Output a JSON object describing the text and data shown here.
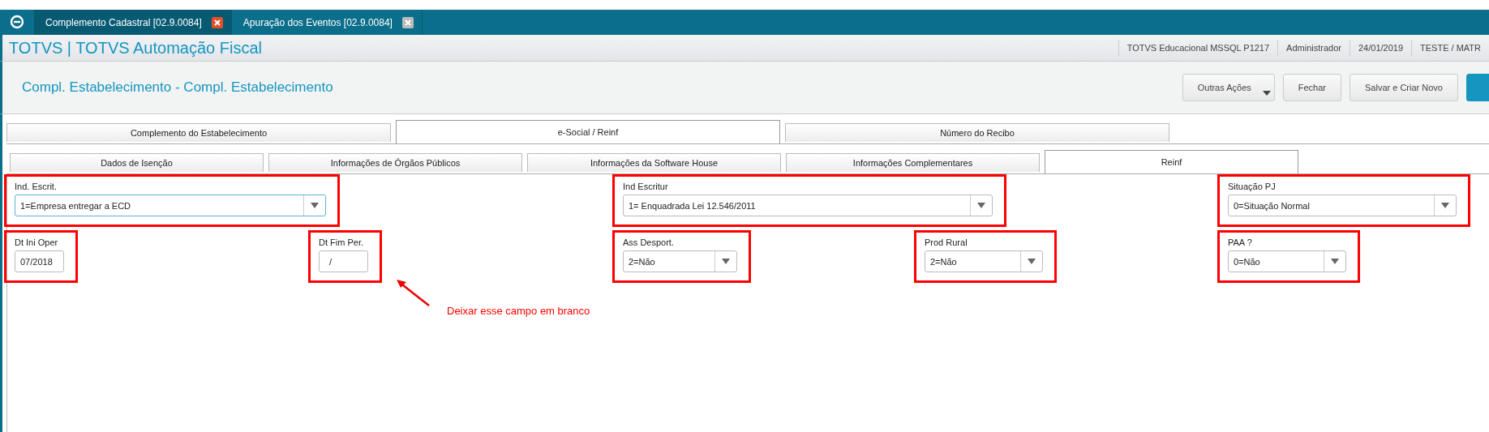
{
  "window_tabs": [
    {
      "label": "Complemento Cadastral [02.9.0084]",
      "selected": true
    },
    {
      "label": "Apuração dos Eventos [02.9.0084]",
      "selected": false
    }
  ],
  "app_title": "TOTVS | TOTVS Automação Fiscal",
  "status_info": [
    "TOTVS Educacional MSSQL P1217",
    "Administrador",
    "24/01/2019",
    "TESTE / MATR"
  ],
  "page_title": "Compl. Estabelecimento - Compl. Estabelecimento",
  "actions": [
    {
      "label": "Outras Ações",
      "kind": "menu"
    },
    {
      "label": "Fechar",
      "kind": "plain"
    },
    {
      "label": "Salvar e Criar Novo",
      "kind": "plain"
    },
    {
      "kind": "primary"
    }
  ],
  "tabs": [
    {
      "label": "Complemento do Estabelecimento",
      "selected": false
    },
    {
      "label": "e-Social / Reinf",
      "selected": true
    },
    {
      "label": "Número do Recibo",
      "selected": false
    }
  ],
  "subtabs": [
    {
      "label": "Dados de Isenção",
      "selected": false
    },
    {
      "label": "Informações de Órgãos Públicos",
      "selected": false
    },
    {
      "label": "Informações da Software House",
      "selected": false
    },
    {
      "label": "Informações Complementares",
      "selected": false
    },
    {
      "label": "Reinf",
      "selected": true
    }
  ],
  "field_rows": [
    [
      {
        "label": "Ind. Escrit.",
        "value": "1=Empresa entregar a ECD",
        "kind": "select",
        "highlighted": true,
        "focused": true
      },
      {
        "label": "Ind Escritur",
        "value": "1= Enquadrada Lei 12.546/2011",
        "kind": "select",
        "highlighted": true,
        "focused": false
      },
      {
        "label": "Situação PJ",
        "value": "0=Situação Normal",
        "kind": "select",
        "highlighted": true,
        "focused": false
      }
    ],
    [
      {
        "label": "Dt Ini Oper",
        "value": "07/2018",
        "kind": "input",
        "highlighted": true,
        "focused": false
      },
      {
        "label": "Dt Fim Per.",
        "value": "  /",
        "kind": "input",
        "highlighted": true,
        "focused": false
      },
      {
        "label": "Ass Desport.",
        "value": "2=Não",
        "kind": "select",
        "highlighted": true,
        "focused": false
      },
      {
        "label": "Prod Rural",
        "value": "2=Não",
        "kind": "select",
        "highlighted": true,
        "focused": false
      },
      {
        "label": "PAA ?",
        "value": "0=Não",
        "kind": "select",
        "highlighted": true,
        "focused": false
      }
    ]
  ],
  "annotation": {
    "text": "Deixar esse campo em branco"
  }
}
